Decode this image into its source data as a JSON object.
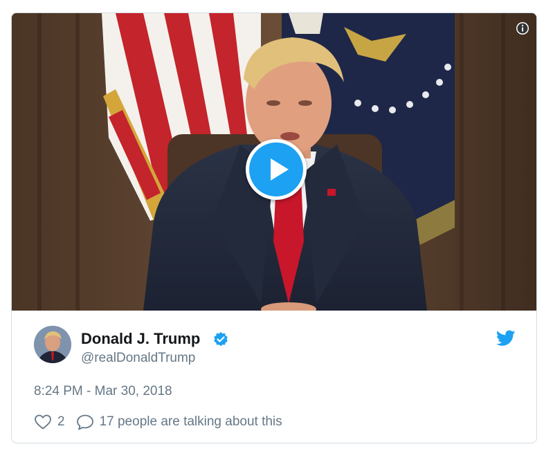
{
  "tweet": {
    "author_name": "Donald J. Trump",
    "author_handle": "@realDonaldTrump",
    "timestamp": "8:24 PM - Mar 30, 2018",
    "like_count": "2",
    "talking_text": "17 people are talking about this",
    "verified": true
  },
  "colors": {
    "twitter_blue": "#1da1f2",
    "text_dark": "#14171a",
    "text_gray": "#657786",
    "border": "#d6dde3"
  },
  "icons": [
    "info-icon",
    "play-icon",
    "verified-icon",
    "twitter-bird-icon",
    "heart-icon",
    "reply-icon"
  ]
}
